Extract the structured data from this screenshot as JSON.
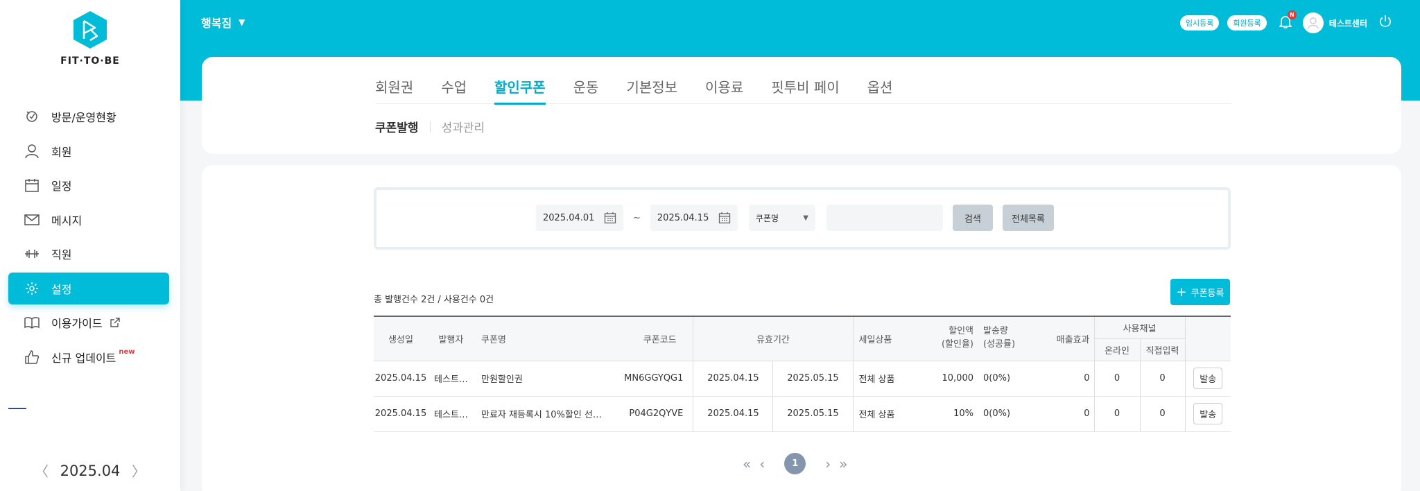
{
  "app": {
    "logo_text": "FIT·TO·BE"
  },
  "sidebar": {
    "items": [
      {
        "label": "방문/운영현황",
        "icon": "visit-icon"
      },
      {
        "label": "회원",
        "icon": "person-icon"
      },
      {
        "label": "일정",
        "icon": "calendar-icon"
      },
      {
        "label": "메시지",
        "icon": "mail-icon"
      },
      {
        "label": "직원",
        "icon": "dumbbell-icon"
      },
      {
        "label": "설정",
        "icon": "gear-icon",
        "active": true
      },
      {
        "label": "이용가이드",
        "icon": "book-icon"
      },
      {
        "label": "신규 업데이트",
        "icon": "thumbs-up-icon",
        "badge": "new"
      }
    ],
    "month": "2025.04"
  },
  "header": {
    "branch": "행복짐",
    "temp_register": "임시등록",
    "member_register": "회원등록",
    "notif_badge": "N",
    "user_name": "테스트센터"
  },
  "tabs": {
    "main": [
      "회원권",
      "수업",
      "할인쿠폰",
      "운동",
      "기본정보",
      "이용료",
      "핏투비 페이",
      "옵션"
    ],
    "active_main": "할인쿠폰",
    "sub": [
      "쿠폰발행",
      "성과관리"
    ],
    "active_sub": "쿠폰발행"
  },
  "search": {
    "date_from": "2025.04.01",
    "tilde": "~",
    "date_to": "2025.04.15",
    "field_select": "쿠폰명",
    "search_button": "검색",
    "list_all_button": "전체목록"
  },
  "summary": "총 발행건수 2건 / 사용건수 0건",
  "add_coupon_button": "쿠폰등록",
  "table": {
    "headers": {
      "created": "생성일",
      "issuer": "발행자",
      "name": "쿠폰명",
      "code": "쿠폰코드",
      "valid_period": "유효기간",
      "sale_product": "세일상품",
      "discount_1": "할인액",
      "discount_2": "(할인율)",
      "sent_1": "발송량",
      "sent_2": "(성공률)",
      "sales_effect": "매출효과",
      "channel": "사용채널",
      "online": "온라인",
      "direct": "직접입력"
    },
    "rows": [
      {
        "created": "2025.04.15",
        "issuer": "테스트…",
        "name": "만원할인권",
        "code": "MN6GGYQG1",
        "valid_from": "2025.04.15",
        "valid_to": "2025.05.15",
        "sale_product": "전체 상품",
        "discount": "10,000",
        "sent": "0(0%)",
        "sales_effect": "0",
        "online": "0",
        "direct": "0",
        "send_button": "발송"
      },
      {
        "created": "2025.04.15",
        "issuer": "테스트…",
        "name": "만료자 재등록시 10%할인 선…",
        "code": "P04G2QYVE",
        "valid_from": "2025.04.15",
        "valid_to": "2025.05.15",
        "sale_product": "전체 상품",
        "discount": "10%",
        "sent": "0(0%)",
        "sales_effect": "0",
        "online": "0",
        "direct": "0",
        "send_button": "발송"
      }
    ]
  },
  "pagination": {
    "current": "1"
  },
  "colors": {
    "accent": "#00bcd9",
    "tab_active": "#00acc8",
    "page_dot": "#8496ad",
    "new_badge": "#e53935"
  }
}
